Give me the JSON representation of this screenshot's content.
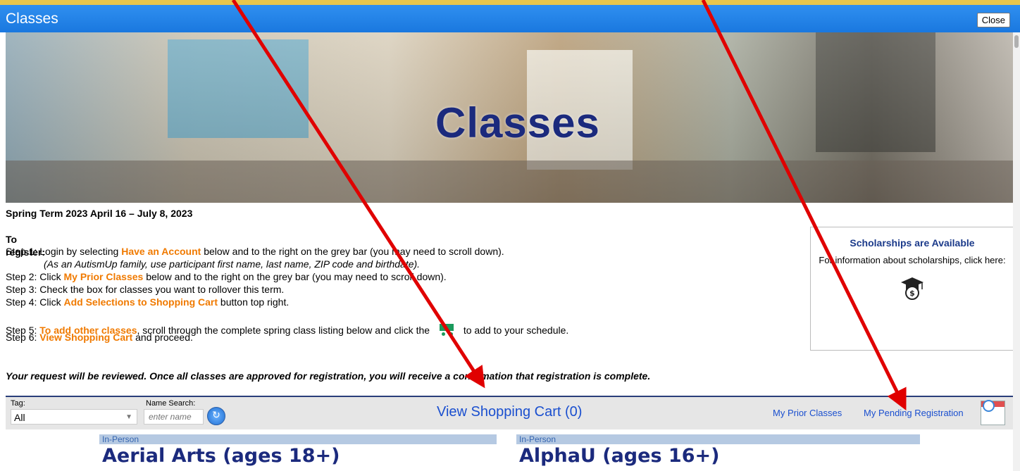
{
  "window": {
    "title": "Classes",
    "close_label": "Close"
  },
  "hero": {
    "title": "Classes"
  },
  "term": "Spring Term 2023 April 16 – July 8, 2023",
  "register_heading": "To register:",
  "steps": {
    "s1_pre": "Step 1: Login by selecting ",
    "s1_link": "Have an Account",
    "s1_post": " below and to the right on the grey bar (you may need to scroll down).",
    "s1_note": "(As an AutismUp family, use participant first name, last name, ZIP code and birthdate).",
    "s2_pre": "Step 2: Click ",
    "s2_link": "My Prior Classes",
    "s2_post": "  below and to the right on the grey bar (you may need to scroll down).",
    "s3": "Step 3: Check the box for classes you want to rollover this term.",
    "s4_pre": "Step 4: Click ",
    "s4_link": "Add Selections to Shopping Cart",
    "s4_post": " button top right.",
    "s5_pre": "Step 5: ",
    "s5_link": "To add other classes",
    "s5_mid": ", scroll through the complete spring class listing below and click the ",
    "s5_post": " to add to your schedule.",
    "s6_pre": "Step 6: ",
    "s6_link": "View Shopping Cart",
    "s6_post": " and proceed."
  },
  "notice": "Your request will be reviewed. Once all classes are approved for registration, you will receive a confirmation that registration is complete.",
  "scholarship": {
    "heading": "Scholarships are Available",
    "text": "For information about scholarships, click here:",
    "icon": "graduation-cap-dollar-icon"
  },
  "filter": {
    "tag_label": "Tag:",
    "tag_value": "All",
    "name_label": "Name Search:",
    "name_placeholder": "enter name",
    "view_cart": "View Shopping Cart (0)",
    "prior_classes": "My Prior Classes",
    "pending_registration": "My Pending Registration"
  },
  "classes": [
    {
      "type": "In-Person",
      "name": "Aerial Arts (ages 18+)"
    },
    {
      "type": "In-Person",
      "name": "AlphaU (ages 16+)"
    }
  ],
  "colors": {
    "titlebar": "#1a78df",
    "accent_orange": "#f07a00",
    "link_blue": "#1a4fcf",
    "heading_navy": "#1b2a7d",
    "annotation_red": "#e00000"
  }
}
